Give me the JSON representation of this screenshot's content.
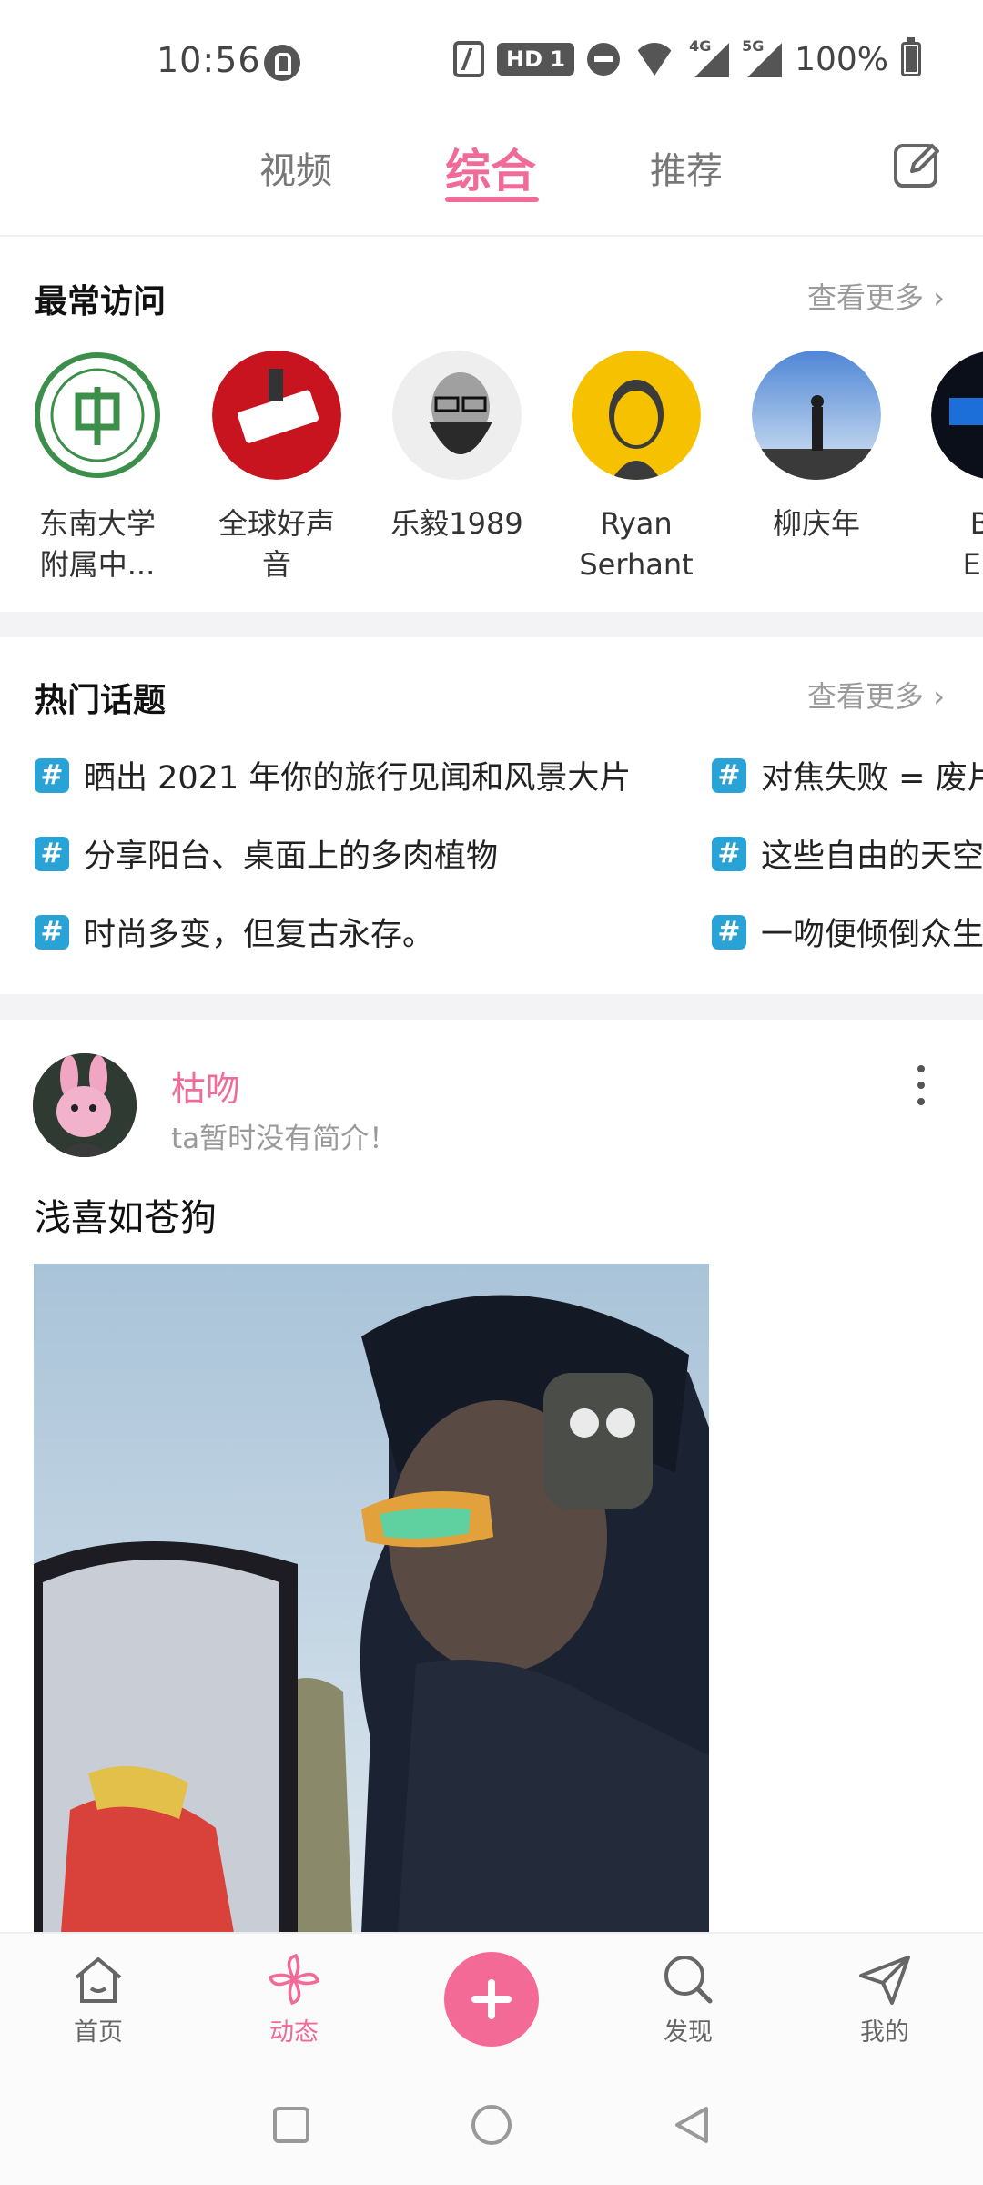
{
  "status_bar": {
    "time": "10:56",
    "hd_badge": "HD 1",
    "network_4g": "4G",
    "network_5g": "5G",
    "battery": "100%"
  },
  "top_tabs": {
    "items": [
      {
        "label": "视频"
      },
      {
        "label": "综合"
      },
      {
        "label": "推荐"
      }
    ],
    "active": "综合"
  },
  "frequent_visits": {
    "title": "最常访问",
    "see_more": "查看更多 ›",
    "items": [
      {
        "name_line1": "东南大学",
        "name_line2": "附属中..."
      },
      {
        "name_line1": "全球好声",
        "name_line2": "音"
      },
      {
        "name_line1": "乐毅1989",
        "name_line2": ""
      },
      {
        "name_line1": "Ryan",
        "name_line2": "Serhant"
      },
      {
        "name_line1": "柳庆年",
        "name_line2": ""
      },
      {
        "name_line1": "Bliz",
        "name_line2": "Ente"
      }
    ]
  },
  "hot_topics": {
    "title": "热门话题",
    "see_more": "查看更多 ›",
    "hash_symbol": "#",
    "left_column": [
      "晒出 2021 年你的旅行见闻和风景大片",
      "分享阳台、桌面上的多肉植物",
      "时尚多变，但复古永存。"
    ],
    "right_column": [
      "对焦失败 = 废片",
      "这些自由的天空",
      "一吻便倾倒众生"
    ]
  },
  "post": {
    "author": "枯吻",
    "bio": "ta暂时没有简介！",
    "text": "浅喜如苍狗"
  },
  "bottom_nav": {
    "items": [
      {
        "label": "首页",
        "icon": "home-icon"
      },
      {
        "label": "动态",
        "icon": "pinwheel-icon"
      },
      {
        "label": "发现",
        "icon": "search-icon"
      },
      {
        "label": "我的",
        "icon": "send-icon"
      }
    ],
    "active": "动态",
    "accent_color": "#f06b98"
  }
}
